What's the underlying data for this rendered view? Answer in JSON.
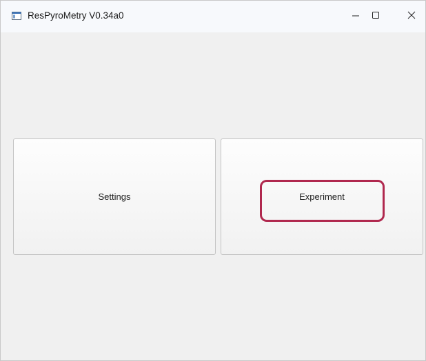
{
  "window": {
    "title": "ResPyroMetry V0.34a0",
    "icon": "app-window-icon",
    "controls": {
      "minimize_icon": "minimize-icon",
      "maximize_icon": "maximize-icon",
      "close_icon": "close-icon"
    }
  },
  "main": {
    "settings_label": "Settings",
    "experiment_label": "Experiment"
  },
  "colors": {
    "highlight": "#b0284e",
    "background": "#f0f0f0"
  }
}
